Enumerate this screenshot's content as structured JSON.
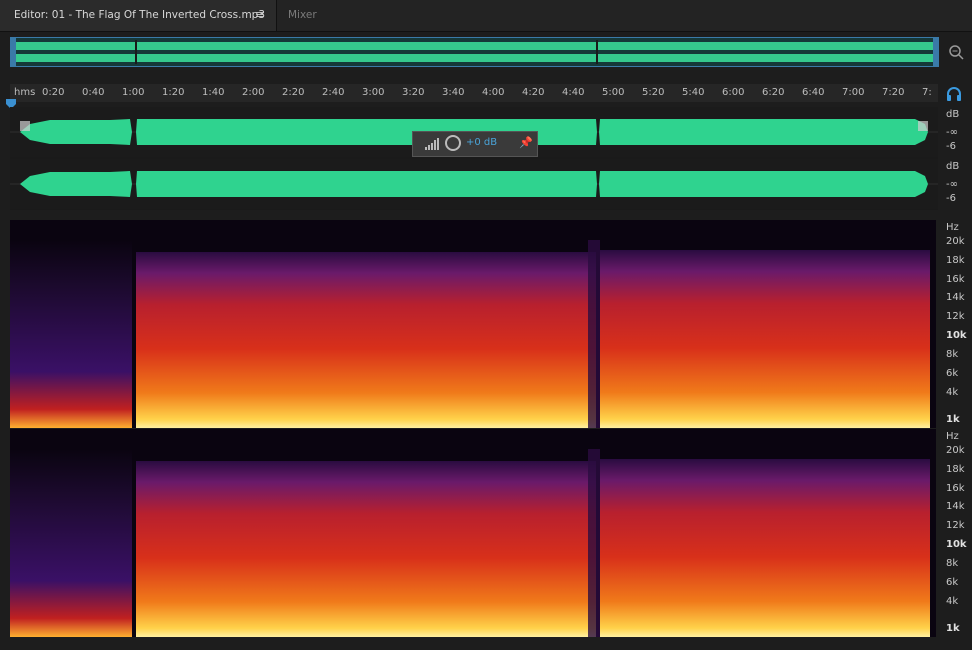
{
  "tabs": {
    "editor_label": "Editor: 01 - The Flag Of The Inverted Cross.mp3",
    "menu_icon": "≡",
    "mixer_label": "Mixer"
  },
  "ruler": {
    "unit": "hms",
    "labels": [
      "0:20",
      "0:40",
      "1:00",
      "1:20",
      "1:40",
      "2:00",
      "2:20",
      "2:40",
      "3:00",
      "3:20",
      "3:40",
      "4:00",
      "4:20",
      "4:40",
      "5:00",
      "5:20",
      "5:40",
      "6:00",
      "6:20",
      "6:40",
      "7:00",
      "7:20",
      "7:"
    ]
  },
  "waveform": {
    "color": "#2fd38f",
    "channel1_scale": {
      "unit": "dB",
      "top": "-∞",
      "bottom": "-6"
    },
    "channel2_scale": {
      "unit": "dB",
      "top": "-∞",
      "bottom": "-6"
    }
  },
  "hud": {
    "volume": "+0 dB"
  },
  "spectral": {
    "channel1_scale": {
      "unit": "Hz",
      "labels": [
        "20k",
        "18k",
        "16k",
        "14k",
        "12k",
        "10k",
        "8k",
        "6k",
        "4k",
        "1k"
      ]
    },
    "channel2_scale": {
      "unit": "Hz",
      "labels": [
        "20k",
        "18k",
        "16k",
        "14k",
        "12k",
        "10k",
        "8k",
        "6k",
        "4k",
        "1k"
      ]
    }
  },
  "icons": {
    "overview_zoom": "zoom-icon",
    "headphones": "headphones-icon",
    "pin": "pin-icon",
    "playhead": "playhead-marker-icon"
  }
}
